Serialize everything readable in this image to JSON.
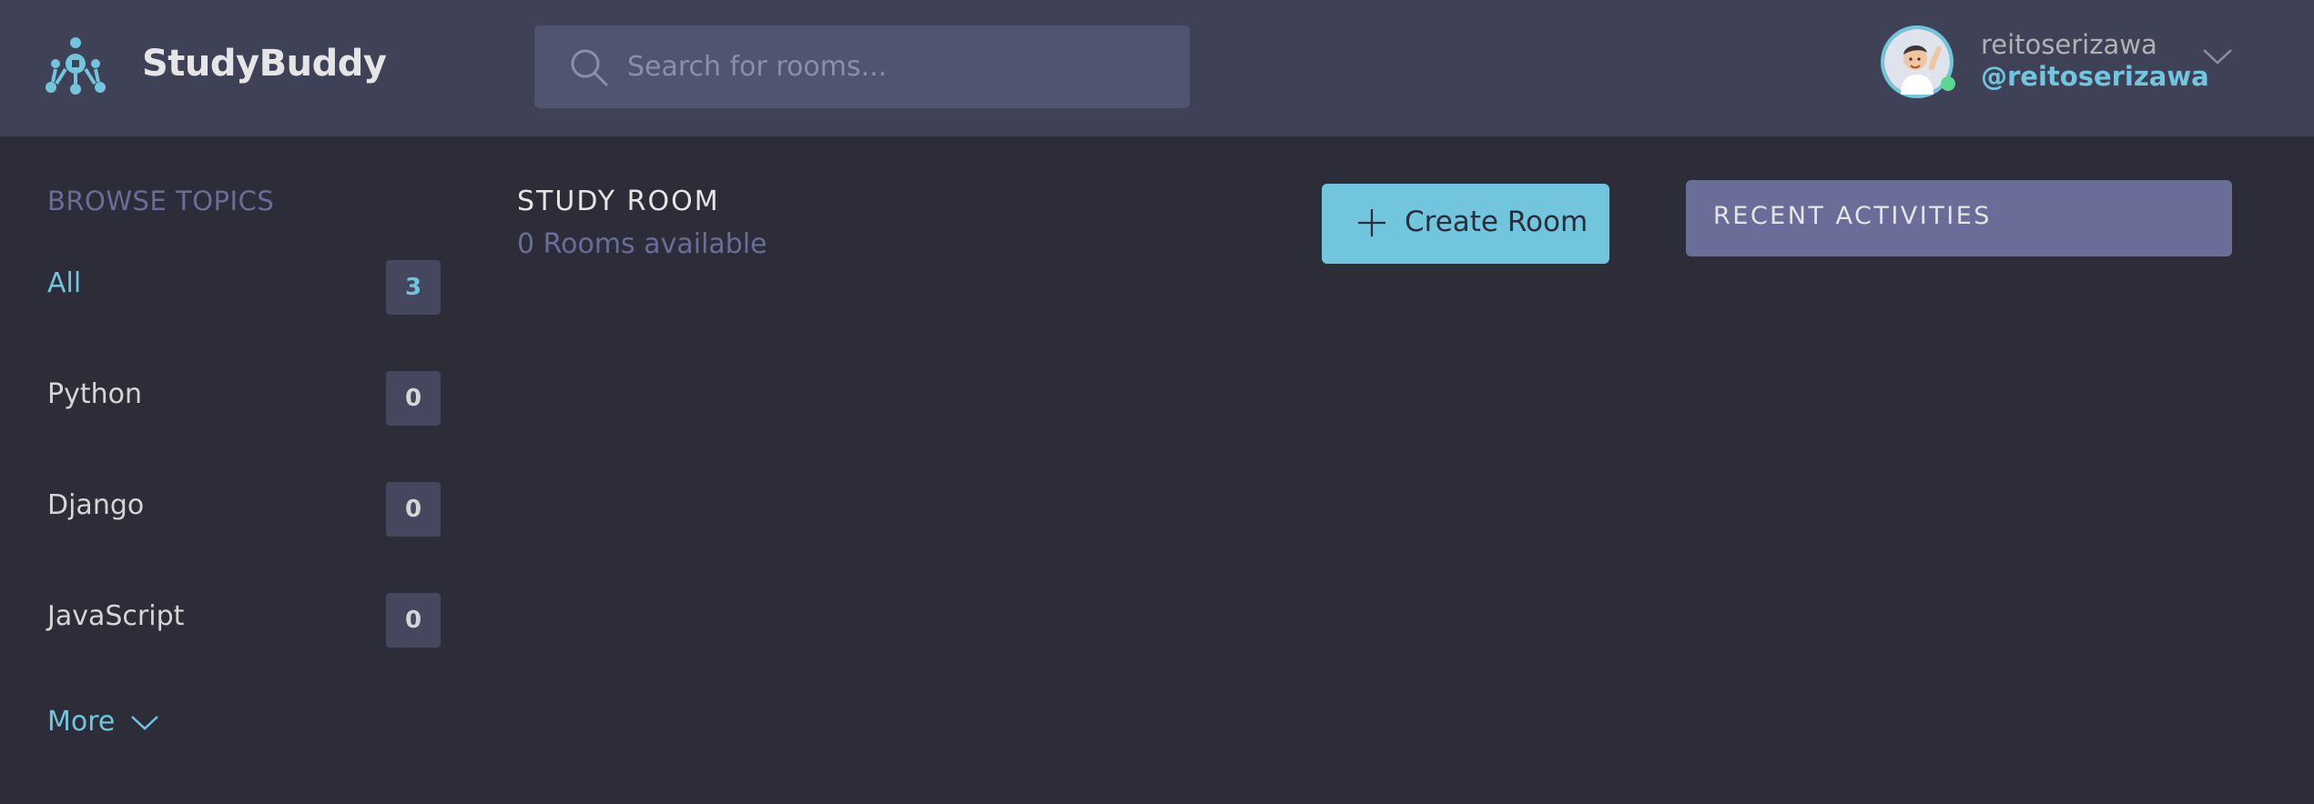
{
  "header": {
    "brand": "StudyBuddy",
    "logo_icon": "studybuddy-logo-icon",
    "search": {
      "placeholder": "Search for rooms...",
      "value": "",
      "icon": "search-icon"
    },
    "user": {
      "name": "reitoserizawa",
      "handle": "@reitoserizawa",
      "status": "online",
      "dropdown_icon": "chevron-down-icon"
    }
  },
  "sidebar": {
    "title": "BROWSE TOPICS",
    "topics": [
      {
        "label": "All",
        "count": "3",
        "active": true
      },
      {
        "label": "Python",
        "count": "0",
        "active": false
      },
      {
        "label": "Django",
        "count": "0",
        "active": false
      },
      {
        "label": "JavaScript",
        "count": "0",
        "active": false
      }
    ],
    "more_label": "More",
    "more_icon": "chevron-down-icon"
  },
  "main": {
    "title": "STUDY ROOM",
    "subtitle": "0 Rooms available",
    "create_button": {
      "label": "Create Room",
      "icon": "plus-icon"
    }
  },
  "activities": {
    "title": "RECENT ACTIVITIES"
  },
  "colors": {
    "background": "#2d2d39",
    "header": "#3f4156",
    "search": "#51546e",
    "accent": "#71c6dd",
    "muted": "#696d97",
    "badge": "#44475d",
    "online": "#5dd693"
  }
}
